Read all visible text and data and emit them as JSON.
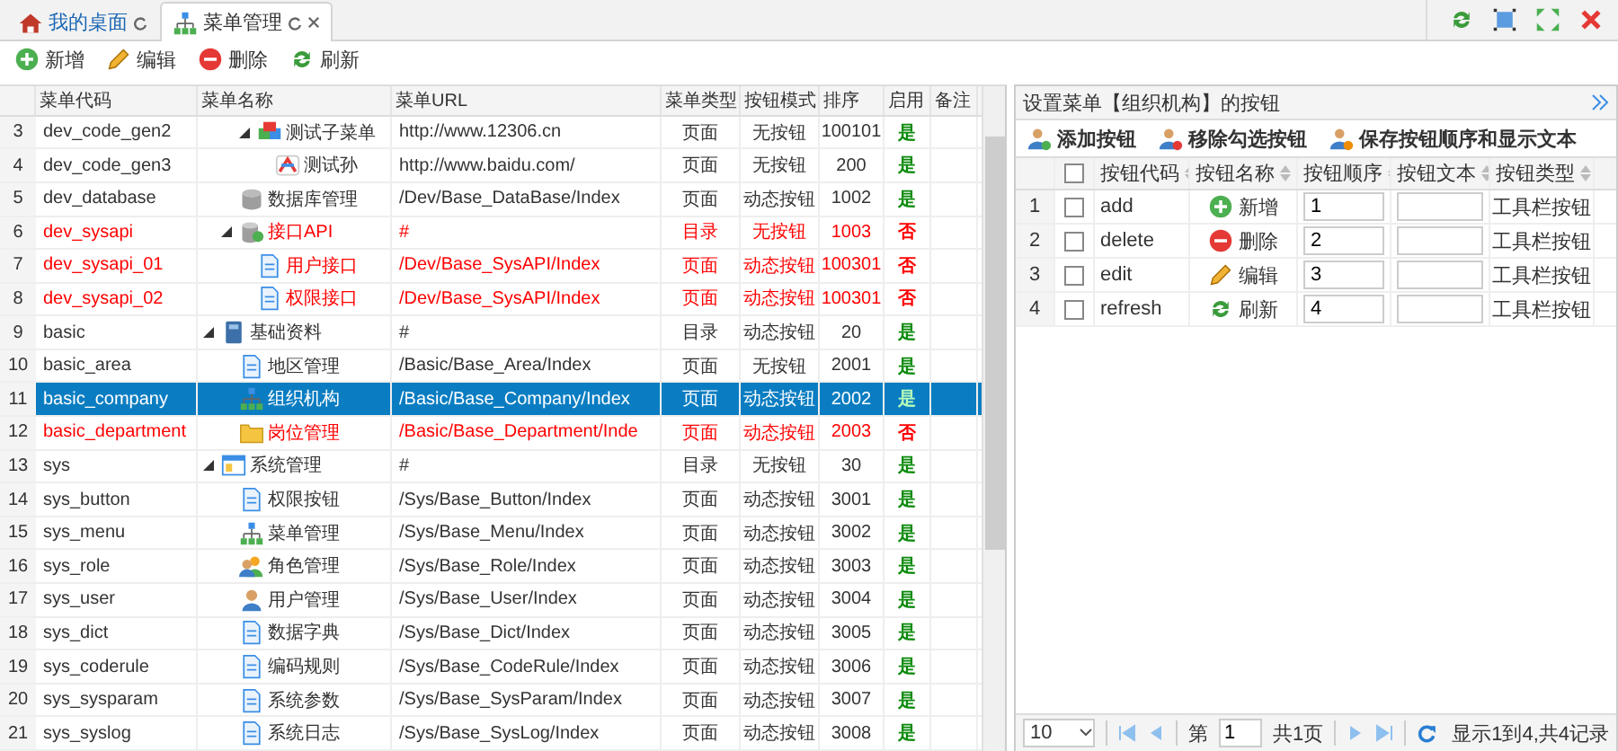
{
  "tabs": [
    {
      "label": "我的桌面",
      "kind": "home",
      "selected": false,
      "closable": false
    },
    {
      "label": "菜单管理",
      "kind": "org",
      "selected": true,
      "closable": true
    }
  ],
  "toolbar": [
    {
      "label": "新增",
      "kind": "add"
    },
    {
      "label": "编辑",
      "kind": "edit"
    },
    {
      "label": "删除",
      "kind": "delete"
    },
    {
      "label": "刷新",
      "kind": "refresh"
    }
  ],
  "menu_table": {
    "columns": [
      "菜单代码",
      "菜单名称",
      "菜单URL",
      "菜单类型",
      "按钮模式",
      "排序",
      "启用",
      "备注"
    ],
    "rows": [
      {
        "children": [
          {
            "children": [
              {
                "number": "3",
                "code": "dev_code_gen2",
                "name": "测试子菜单",
                "kind": "cubes",
                "expanded": true,
                "url": "http://www.12306.cn",
                "type": "页面",
                "mode": "无按钮",
                "sort": "100101",
                "enabled": true,
                "enabled_label": "是",
                "selected": false,
                "children": [
                  {
                    "number": "4",
                    "code": "dev_code_gen3",
                    "name": "测试孙",
                    "kind": "logo",
                    "url": "http://www.baidu.com/",
                    "type": "页面",
                    "mode": "无按钮",
                    "sort": "200",
                    "enabled": true,
                    "enabled_label": "是",
                    "selected": false
                  }
                ]
              }
            ]
          },
          {
            "number": "5",
            "code": "dev_database",
            "name": "数据库管理",
            "kind": "database",
            "url": "/Dev/Base_DataBase/Index",
            "type": "页面",
            "mode": "动态按钮",
            "sort": "1002",
            "enabled": true,
            "enabled_label": "是",
            "selected": false
          },
          {
            "number": "6",
            "code": "dev_sysapi",
            "name": "接口API",
            "kind": "api",
            "expanded": true,
            "url": "#",
            "type": "目录",
            "mode": "无按钮",
            "sort": "1003",
            "enabled": false,
            "enabled_label": "否",
            "selected": false,
            "children": [
              {
                "number": "7",
                "code": "dev_sysapi_01",
                "name": "用户接口",
                "kind": "page",
                "url": "/Dev/Base_SysAPI/Index",
                "type": "页面",
                "mode": "动态按钮",
                "sort": "100301",
                "enabled": false,
                "enabled_label": "否",
                "selected": false
              },
              {
                "number": "8",
                "code": "dev_sysapi_02",
                "name": "权限接口",
                "kind": "page",
                "url": "/Dev/Base_SysAPI/Index",
                "type": "页面",
                "mode": "动态按钮",
                "sort": "100301",
                "enabled": false,
                "enabled_label": "否",
                "selected": false
              }
            ]
          }
        ]
      },
      {
        "number": "9",
        "code": "basic",
        "name": "基础资料",
        "kind": "book",
        "expanded": true,
        "url": "#",
        "type": "目录",
        "mode": "动态按钮",
        "sort": "20",
        "enabled": true,
        "enabled_label": "是",
        "selected": false,
        "children": [
          {
            "number": "10",
            "code": "basic_area",
            "name": "地区管理",
            "kind": "page",
            "url": "/Basic/Base_Area/Index",
            "type": "页面",
            "mode": "无按钮",
            "sort": "2001",
            "enabled": true,
            "enabled_label": "是",
            "selected": false
          },
          {
            "number": "11",
            "code": "basic_company",
            "name": "组织机构",
            "kind": "org",
            "url": "/Basic/Base_Company/Index",
            "type": "页面",
            "mode": "动态按钮",
            "sort": "2002",
            "enabled": true,
            "enabled_label": "是",
            "selected": true
          },
          {
            "number": "12",
            "code": "basic_department",
            "name": "岗位管理",
            "kind": "folder",
            "url": "/Basic/Base_Department/Inde",
            "type": "页面",
            "mode": "动态按钮",
            "sort": "2003",
            "enabled": false,
            "enabled_label": "否",
            "selected": false
          }
        ]
      },
      {
        "number": "13",
        "code": "sys",
        "name": "系统管理",
        "kind": "window",
        "expanded": true,
        "url": "#",
        "type": "目录",
        "mode": "无按钮",
        "sort": "30",
        "enabled": true,
        "enabled_label": "是",
        "selected": false,
        "children": [
          {
            "number": "14",
            "code": "sys_button",
            "name": "权限按钮",
            "kind": "page",
            "url": "/Sys/Base_Button/Index",
            "type": "页面",
            "mode": "动态按钮",
            "sort": "3001",
            "enabled": true,
            "enabled_label": "是",
            "selected": false
          },
          {
            "number": "15",
            "code": "sys_menu",
            "name": "菜单管理",
            "kind": "org",
            "url": "/Sys/Base_Menu/Index",
            "type": "页面",
            "mode": "动态按钮",
            "sort": "3002",
            "enabled": true,
            "enabled_label": "是",
            "selected": false
          },
          {
            "number": "16",
            "code": "sys_role",
            "name": "角色管理",
            "kind": "users",
            "url": "/Sys/Base_Role/Index",
            "type": "页面",
            "mode": "动态按钮",
            "sort": "3003",
            "enabled": true,
            "enabled_label": "是",
            "selected": false
          },
          {
            "number": "17",
            "code": "sys_user",
            "name": "用户管理",
            "kind": "user",
            "url": "/Sys/Base_User/Index",
            "type": "页面",
            "mode": "动态按钮",
            "sort": "3004",
            "enabled": true,
            "enabled_label": "是",
            "selected": false
          },
          {
            "number": "18",
            "code": "sys_dict",
            "name": "数据字典",
            "kind": "page",
            "url": "/Sys/Base_Dict/Index",
            "type": "页面",
            "mode": "动态按钮",
            "sort": "3005",
            "enabled": true,
            "enabled_label": "是",
            "selected": false
          },
          {
            "number": "19",
            "code": "sys_coderule",
            "name": "编码规则",
            "kind": "page",
            "url": "/Sys/Base_CodeRule/Index",
            "type": "页面",
            "mode": "动态按钮",
            "sort": "3006",
            "enabled": true,
            "enabled_label": "是",
            "selected": false
          },
          {
            "number": "20",
            "code": "sys_sysparam",
            "name": "系统参数",
            "kind": "page",
            "url": "/Sys/Base_SysParam/Index",
            "type": "页面",
            "mode": "动态按钮",
            "sort": "3007",
            "enabled": true,
            "enabled_label": "是",
            "selected": false
          },
          {
            "number": "21",
            "code": "sys_syslog",
            "name": "系统日志",
            "kind": "page",
            "url": "/Sys/Base_SysLog/Index",
            "type": "页面",
            "mode": "动态按钮",
            "sort": "3008",
            "enabled": true,
            "enabled_label": "是",
            "selected": false
          }
        ]
      }
    ]
  },
  "button_panel": {
    "title": "设置菜单【组织机构】的按钮",
    "toolbar": [
      {
        "label": "添加按钮",
        "kind": "user-add"
      },
      {
        "label": "移除勾选按钮",
        "kind": "user-remove"
      },
      {
        "label": "保存按钮顺序和显示文本",
        "kind": "user-save"
      }
    ],
    "columns": [
      "按钮代码",
      "按钮名称",
      "按钮顺序",
      "按钮文本",
      "按钮类型"
    ],
    "select_all": {
      "checked": false
    },
    "rows": [
      {
        "number": "1",
        "checked": false,
        "code": "add",
        "name": "新增",
        "kind": "add",
        "order": "1",
        "type": "工具栏按钮"
      },
      {
        "number": "2",
        "checked": false,
        "code": "delete",
        "name": "删除",
        "kind": "delete",
        "order": "2",
        "type": "工具栏按钮"
      },
      {
        "number": "3",
        "checked": false,
        "code": "edit",
        "name": "编辑",
        "kind": "edit",
        "order": "3",
        "type": "工具栏按钮"
      },
      {
        "number": "4",
        "checked": false,
        "code": "refresh",
        "name": "刷新",
        "kind": "refresh",
        "order": "4",
        "type": "工具栏按钮"
      }
    ],
    "pager": {
      "page_size": "10",
      "page_prefix": "第",
      "page": "1",
      "page_total": "共1页",
      "summary": "显示1到4,共4记录"
    }
  }
}
